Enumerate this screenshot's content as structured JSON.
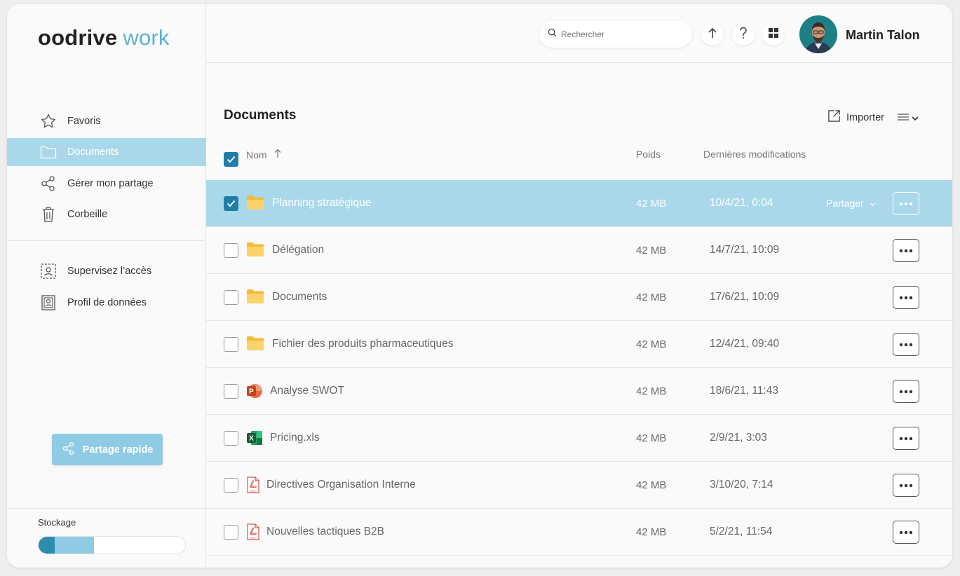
{
  "logo": {
    "part1": "oodrive",
    "part2": "work"
  },
  "sidebar": {
    "items": [
      {
        "label": "Favoris",
        "icon": "star-icon"
      },
      {
        "label": "Documents",
        "icon": "folder-icon",
        "active": true
      },
      {
        "label": "Gérer mon partage",
        "icon": "share-icon"
      },
      {
        "label": "Corbeille",
        "icon": "trash-icon"
      }
    ],
    "secondary": [
      {
        "label": "Supervisez l’accès",
        "icon": "access-icon"
      },
      {
        "label": "Profil de données",
        "icon": "profile-icon"
      }
    ],
    "quick_share": "Partage rapide",
    "storage_label": "Stockage",
    "storage_used_fraction": 0.38,
    "storage_segment_fraction": 0.11
  },
  "header": {
    "search_placeholder": "Rechercher",
    "user_name": "Martin Talon",
    "icons": [
      "upload-icon",
      "help-icon",
      "apps-grid-icon"
    ]
  },
  "main": {
    "title": "Documents",
    "import_label": "Importer",
    "columns": {
      "name": "Nom",
      "size": "Poids",
      "modified": "Dernières modifications"
    },
    "share_label": "Partager",
    "rows": [
      {
        "name": "Planning stratégique",
        "type": "folder",
        "size": "42 MB",
        "date": "10/4/21, 0:04",
        "selected": true
      },
      {
        "name": "Délégation",
        "type": "folder",
        "size": "42 MB",
        "date": "14/7/21, 10:09"
      },
      {
        "name": "Documents",
        "type": "folder",
        "size": "42 MB",
        "date": "17/6/21, 10:09"
      },
      {
        "name": "Fichier des produits pharmaceutiques",
        "type": "folder",
        "size": "42 MB",
        "date": "12/4/21, 09:40"
      },
      {
        "name": "Analyse SWOT",
        "type": "ppt",
        "size": "42 MB",
        "date": "18/6/21, 11:43"
      },
      {
        "name": "Pricing.xls",
        "type": "xls",
        "size": "42 MB",
        "date": "2/9/21, 3:03"
      },
      {
        "name": "Directives Organisation Interne",
        "type": "pdf",
        "size": "42 MB",
        "date": "3/10/20, 7:14"
      },
      {
        "name": "Nouvelles tactiques B2B",
        "type": "pdf",
        "size": "42 MB",
        "date": "5/2/21, 11:54"
      }
    ]
  },
  "colors": {
    "accent": "#a9d8ea",
    "primary": "#1f7ea8",
    "logo_accent": "#5ab3d6",
    "folder": "#f7c843"
  }
}
